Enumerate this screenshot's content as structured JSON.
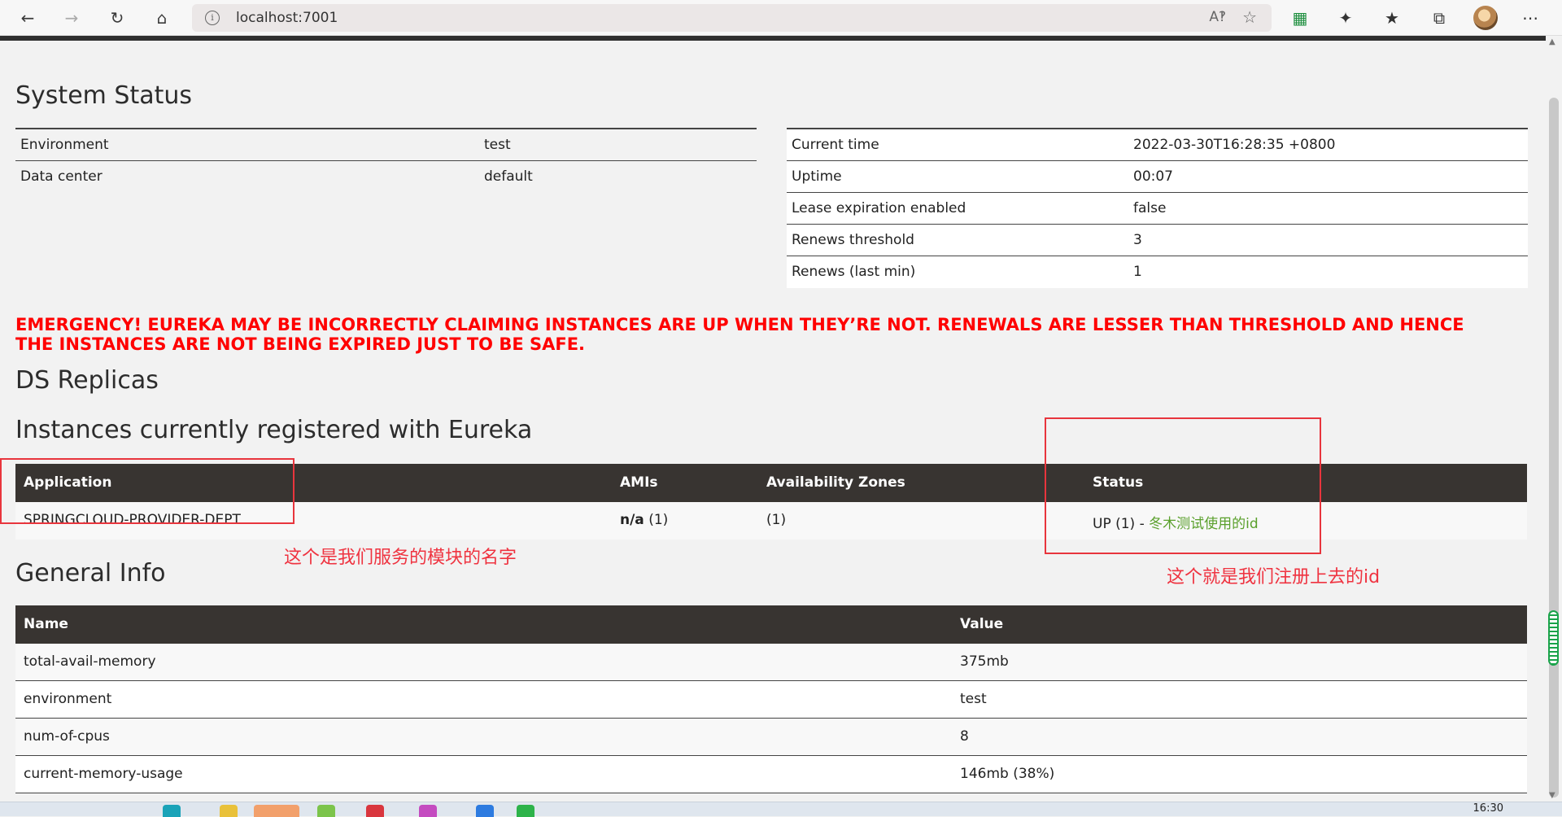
{
  "browser": {
    "url": "localhost:7001",
    "icons": [
      "back-icon",
      "forward-icon",
      "refresh-icon",
      "home-icon",
      "info-icon",
      "read-aloud-icon",
      "add-favorite-icon",
      "excel-icon",
      "extensions-icon",
      "favorites-icon",
      "collections-icon",
      "profile-avatar",
      "more-icon"
    ]
  },
  "system_status": {
    "title": "System Status",
    "left": [
      {
        "label": "Environment",
        "value": "test"
      },
      {
        "label": "Data center",
        "value": "default"
      }
    ],
    "right": [
      {
        "label": "Current time",
        "value": "2022-03-30T16:28:35 +0800"
      },
      {
        "label": "Uptime",
        "value": "00:07"
      },
      {
        "label": "Lease expiration enabled",
        "value": "false"
      },
      {
        "label": "Renews threshold",
        "value": "3"
      },
      {
        "label": "Renews (last min)",
        "value": "1"
      }
    ]
  },
  "emergency": "EMERGENCY! EUREKA MAY BE INCORRECTLY CLAIMING INSTANCES ARE UP WHEN THEY’RE NOT. RENEWALS ARE LESSER THAN THRESHOLD AND HENCE THE INSTANCES ARE NOT BEING EXPIRED JUST TO BE SAFE.",
  "ds_replicas": {
    "title": "DS Replicas"
  },
  "instances": {
    "title": "Instances currently registered with Eureka",
    "headers": [
      "Application",
      "AMIs",
      "Availability Zones",
      "Status"
    ],
    "rows": [
      {
        "application": "SPRINGCLOUD-PROVIDER-DEPT",
        "amis_label": "n/a",
        "amis_count": "(1)",
        "zones": "(1)",
        "status_prefix": "UP (1) - ",
        "status_link": "冬木测试使用的id"
      }
    ]
  },
  "annotations": {
    "app_note": "这个是我们服务的模块的名字",
    "status_note": "这个就是我们注册上去的id"
  },
  "general_info": {
    "title": "General Info",
    "headers": [
      "Name",
      "Value"
    ],
    "rows": [
      {
        "name": "total-avail-memory",
        "value": "375mb"
      },
      {
        "name": "environment",
        "value": "test"
      },
      {
        "name": "num-of-cpus",
        "value": "8"
      },
      {
        "name": "current-memory-usage",
        "value": "146mb (38%)"
      }
    ]
  },
  "taskbar": {
    "clock": "16:30"
  },
  "colors": {
    "emergency": "#ff0000",
    "annotation": "#ef3340",
    "status_link": "#5aa02c",
    "table_header": "#383431"
  }
}
